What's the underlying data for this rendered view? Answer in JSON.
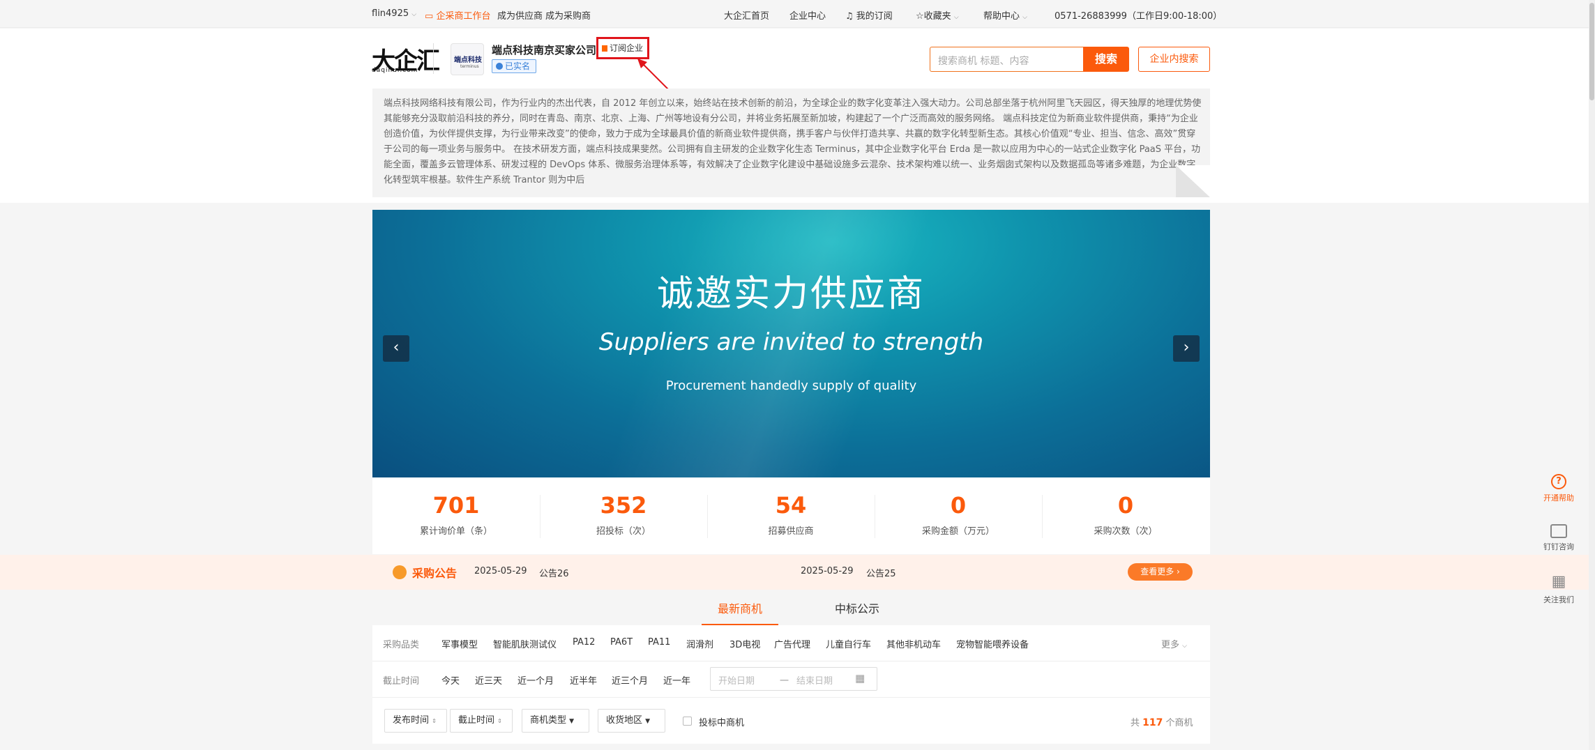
{
  "topbar": {
    "user": "flin4925",
    "workbench": "企采商工作台",
    "become_supplier": "成为供应商",
    "become_buyer": "成为采购商",
    "home": "大企汇首页",
    "enterprise_center": "企业中心",
    "my_subscription": "我的订阅",
    "favorites": "收藏夹",
    "help_center": "帮助中心",
    "hotline": "0571-26883999（工作日9:00-18:00）"
  },
  "header": {
    "logo_text": "大企汇",
    "logo_sub": "daqihui.com",
    "company_logo_text": "端点科技",
    "company_logo_sub": "terminus",
    "company_name": "端点科技南京买家公司",
    "verified": "已实名",
    "subscribe": "订阅企业",
    "search_placeholder": "搜索商机 标题、内容",
    "search_button": "搜索",
    "inner_search_button": "企业内搜索",
    "description": "端点科技网络科技有限公司，作为行业内的杰出代表，自 2012 年创立以来，始终站在技术创新的前沿，为全球企业的数字化变革注入强大动力。公司总部坐落于杭州阿里飞天园区，得天独厚的地理优势使其能够充分汲取前沿科技的养分，同时在青岛、南京、北京、上海、广州等地设有分公司，并将业务拓展至新加坡，构建起了一个广泛而高效的服务网络。 端点科技定位为新商业软件提供商，秉持“为企业创造价值，为伙伴提供支撑，为行业带来改变”的使命，致力于成为全球最具价值的新商业软件提供商，携手客户与伙伴打造共享、共赢的数字化转型新生态。其核心价值观“专业、担当、信念、高效”贯穿于公司的每一项业务与服务中。 在技术研发方面，端点科技成果斐然。公司拥有自主研发的企业数字化生态 Terminus，其中企业数字化平台 Erda 是一款以应用为中心的一站式企业数字化 PaaS 平台，功能全面，覆盖多云管理体系、研发过程的 DevOps 体系、微服务治理体系等，有效解决了企业数字化建设中基础设施多云混杂、技术架构难以统一、业务烟囱式架构以及数据孤岛等诸多难题，为企业数字化转型筑牢根基。软件生产系统 Trantor 则为中后"
  },
  "banner": {
    "title": "诚邀实力供应商",
    "subtitle": "Suppliers are invited to strength",
    "tagline": "Procurement handedly supply of quality",
    "prev": "‹",
    "next": "›"
  },
  "stats": [
    {
      "value": "701",
      "label": "累计询价单（条）"
    },
    {
      "value": "352",
      "label": "招投标（次）"
    },
    {
      "value": "54",
      "label": "招募供应商"
    },
    {
      "value": "0",
      "label": "采购金额（万元）"
    },
    {
      "value": "0",
      "label": "采购次数（次）"
    }
  ],
  "notice": {
    "title": "采购公告",
    "items": [
      {
        "date": "2025-05-29",
        "name": "公告26"
      },
      {
        "date": "2025-05-29",
        "name": "公告25"
      }
    ],
    "more": "查看更多 ›"
  },
  "tabs": [
    "最新商机",
    "中标公示"
  ],
  "filters": {
    "category_label": "采购品类",
    "categories": [
      "军事模型",
      "智能肌肤测试仪",
      "PA12",
      "PA6T",
      "PA11",
      "润滑剂",
      "3D电视",
      "广告代理",
      "儿童自行车",
      "其他非机动车",
      "宠物智能喂养设备"
    ],
    "more": "更多",
    "deadline_label": "截止时间",
    "deadlines": [
      "今天",
      "近三天",
      "近一个月",
      "近半年",
      "近三个月",
      "近一年"
    ],
    "start_date_placeholder": "开始日期",
    "end_date_placeholder": "结束日期",
    "range_sep": "一",
    "sort_publish": "发布时间",
    "sort_deadline": "截止时间",
    "type_select": "商机类型",
    "region_select": "收货地区",
    "bid_checkbox": "投标中商机",
    "total_prefix": "共",
    "total_count": "117",
    "total_suffix": "个商机"
  },
  "side": {
    "help": "开通帮助",
    "dingtalk": "钉钉咨询",
    "follow": "关注我们"
  },
  "colors": {
    "brand": "#fb5a0c",
    "highlight_box": "#e0151b",
    "verified": "#3b82d8"
  }
}
